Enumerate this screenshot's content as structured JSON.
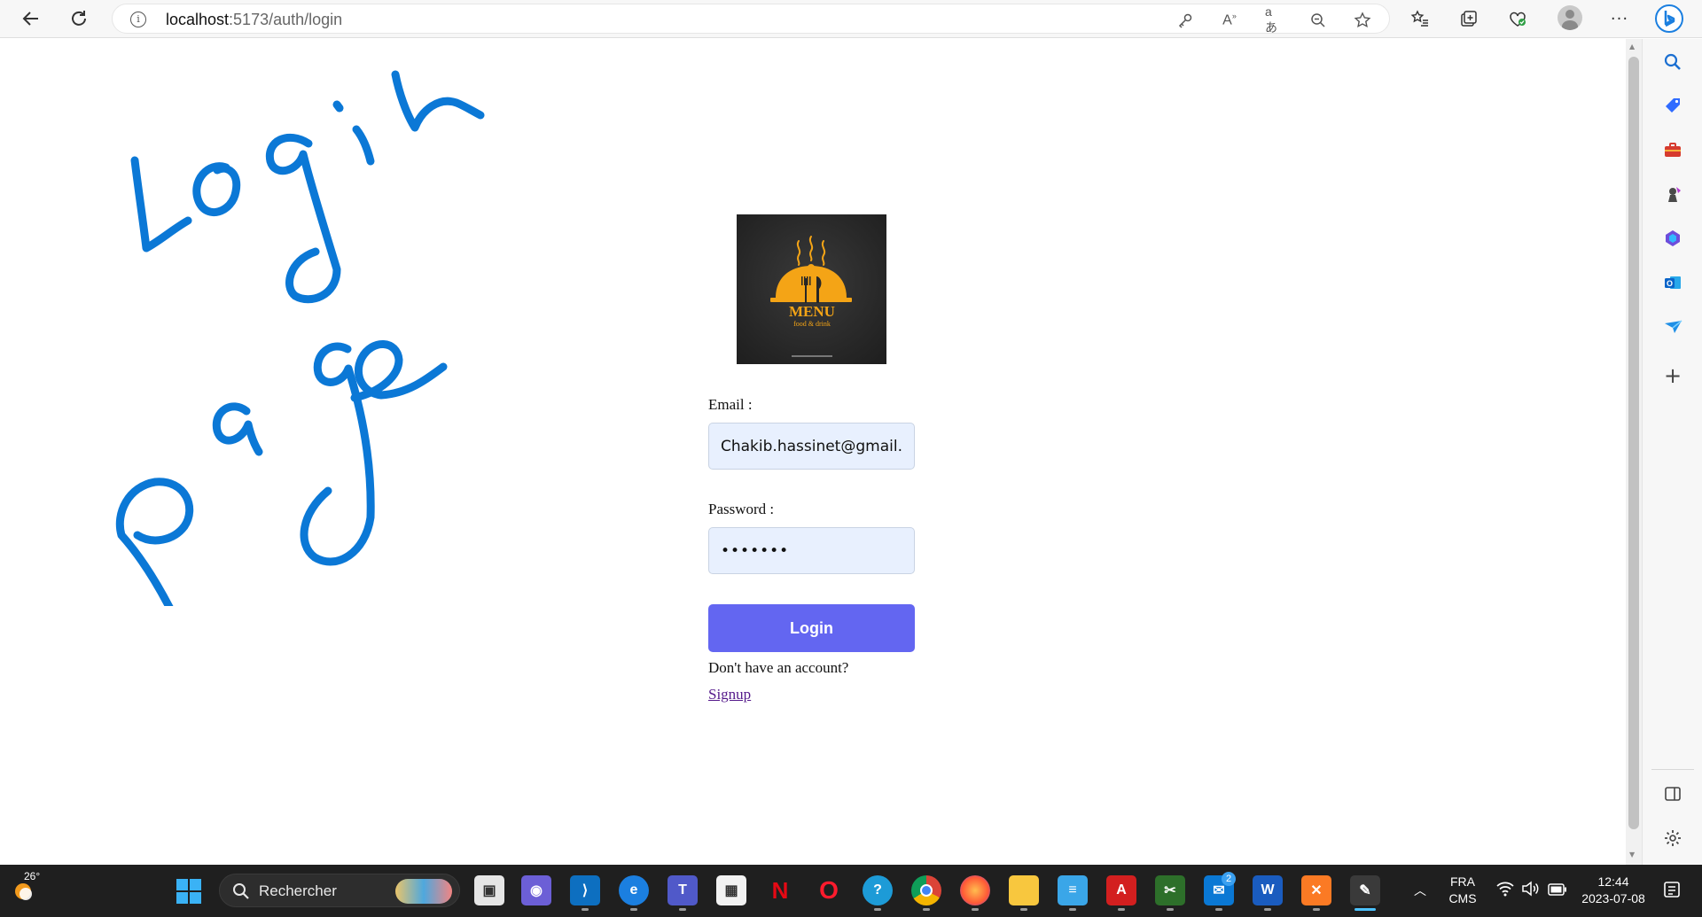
{
  "browser": {
    "url_host": "localhost",
    "url_path": ":5173/auth/login"
  },
  "handwriting": {
    "line1": "Login",
    "line2": "Page"
  },
  "logo": {
    "title": "MENU",
    "subtitle": "food & drink"
  },
  "form": {
    "email_label": "Email :",
    "email_value": "Chakib.hassinet@gmail.com",
    "password_label": "Password :",
    "password_value": "•••••••",
    "login_label": "Login",
    "no_account_text": "Don't have an account?",
    "signup_label": "Signup"
  },
  "taskbar": {
    "weather_temp": "26°",
    "search_label": "Rechercher",
    "mail_badge": "2",
    "lang_line1": "FRA",
    "lang_line2": "CMS",
    "time": "12:44",
    "date": "2023-07-08"
  },
  "colors": {
    "accent": "#6366f1",
    "ink": "#0b78d6",
    "input_bg": "#e8f0fe"
  }
}
